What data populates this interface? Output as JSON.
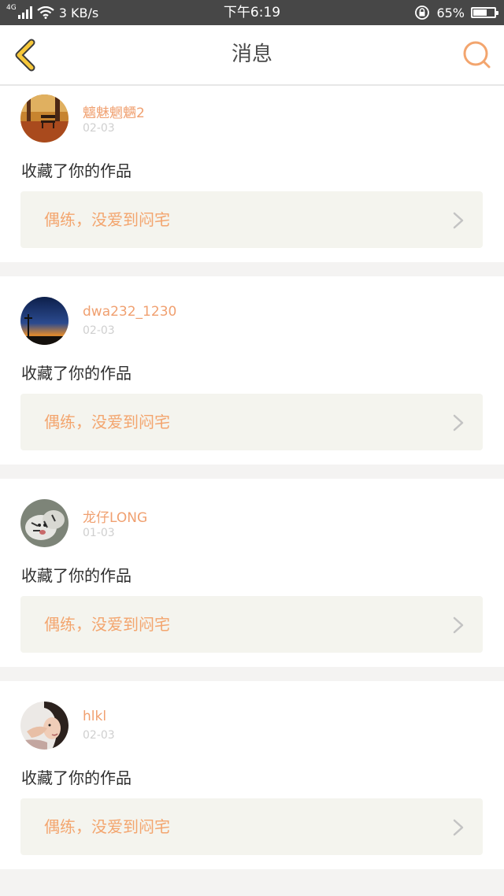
{
  "status_bar": {
    "network_type": "4G",
    "speed": "3 KB/s",
    "time": "下午6:19",
    "battery_percent": "65%",
    "battery_level": 0.65,
    "icons": [
      "signal-icon",
      "wifi-icon",
      "rotation-lock-icon",
      "battery-icon"
    ]
  },
  "nav": {
    "title": "消息",
    "back_icon": "chevron-left-icon",
    "search_icon": "search-icon"
  },
  "colors": {
    "accent": "#f3a56e",
    "back_icon": "#f7c83a",
    "status_bar_bg": "#474747",
    "work_box_bg": "#f4f4ee",
    "page_bg": "#f4f3f2"
  },
  "messages": [
    {
      "username": "魑魅魍魉2",
      "date": "02-03",
      "action": "收藏了你的作品",
      "work_title": "偶练，没爱到闷宅",
      "avatar_icon": "autumn-bench-avatar"
    },
    {
      "username": "dwa232_1230",
      "date": "02-03",
      "action": "收藏了你的作品",
      "work_title": "偶练，没爱到闷宅",
      "avatar_icon": "night-sky-avatar"
    },
    {
      "username": "龙仔LONG",
      "date": "01-03",
      "action": "收藏了你的作品",
      "work_title": "偶练，没爱到闷宅",
      "avatar_icon": "white-tiger-avatar"
    },
    {
      "username": "hlkl",
      "date": "02-03",
      "action": "收藏了你的作品",
      "work_title": "偶练，没爱到闷宅",
      "avatar_icon": "person-avatar"
    }
  ]
}
